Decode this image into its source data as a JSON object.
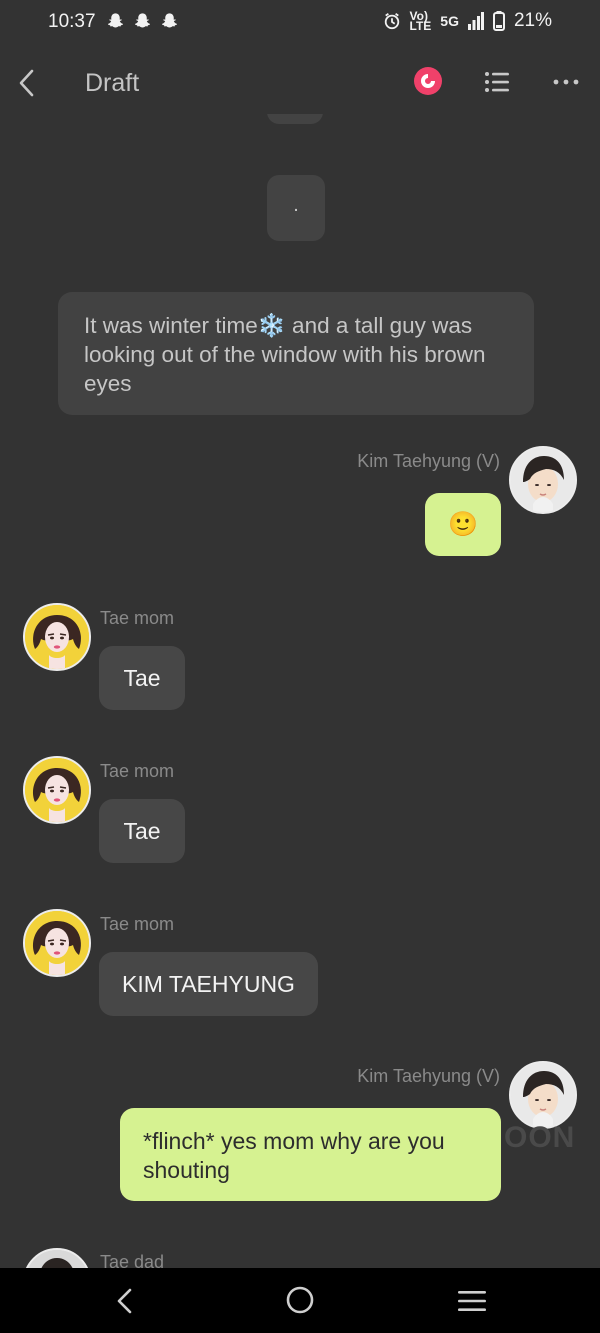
{
  "status_bar": {
    "time": "10:37",
    "network_top": "Vo)",
    "network_bottom": "LTE",
    "network_gen": "5G",
    "battery": "21%"
  },
  "app_bar": {
    "title": "Draft"
  },
  "chat": {
    "dot_message": ".",
    "narration": "It was winter time❄️ and a tall guy was looking out of the window with his brown eyes",
    "messages": [
      {
        "sender": "Kim Taehyung (V)",
        "text": "🙂"
      },
      {
        "sender": "Tae mom",
        "text": "Tae"
      },
      {
        "sender": "Tae mom",
        "text": "Tae"
      },
      {
        "sender": "Tae mom",
        "text": "KIM TAEHYUNG"
      },
      {
        "sender": "Kim Taehyung (V)",
        "text": "*flinch* yes mom why are you shouting"
      },
      {
        "sender": "Tae dad",
        "text": ""
      }
    ],
    "watermark": "OON"
  },
  "colors": {
    "background": "#333333",
    "incoming_bubble": "#474747",
    "outgoing_bubble": "#d6f291",
    "record_accent": "#f0416a",
    "mom_avatar_bg": "#f2d23a"
  }
}
